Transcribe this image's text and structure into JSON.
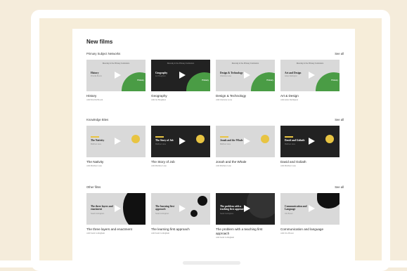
{
  "page": {
    "title": "New films"
  },
  "sections": [
    {
      "title": "Primary Subject Networks",
      "see_all": "See all",
      "cards": [
        {
          "thumb_top": "Diversity in the Primary Curriculum",
          "thumb_title": "History",
          "thumb_sub": "Priscilla Broom",
          "badge": "Primary",
          "title": "History",
          "subtitle": "with Priscilla Broom"
        },
        {
          "thumb_top": "Diversity in the Primary Curriculum",
          "thumb_title": "Geography",
          "thumb_sub": "Jez Boughton",
          "badge": "Primary",
          "title": "Geography",
          "subtitle": "with Jez Boughton"
        },
        {
          "thumb_top": "Diversity in the Primary Curriculum",
          "thumb_title": "Design & Technology",
          "thumb_sub": "Charlotte Lowe",
          "badge": "Primary",
          "title": "Design & Technology",
          "subtitle": "with Charlotte Lowe"
        },
        {
          "thumb_top": "Diversity in the Primary Curriculum",
          "thumb_title": "Art and Design",
          "thumb_sub": "Adele Darlington",
          "badge": "Primary",
          "title": "Art & Design",
          "subtitle": "with Adele Darlington"
        }
      ]
    },
    {
      "title": "Knowledge Bites",
      "see_all": "See all",
      "cards": [
        {
          "thumb_title": "The Nativity",
          "thumb_sub": "Matthew Lane",
          "title": "The Nativity",
          "subtitle": "with Matthew Lane"
        },
        {
          "thumb_title": "The Story of Job",
          "thumb_sub": "Matthew Lane",
          "title": "The Story of Job",
          "subtitle": "with Matthew Lane"
        },
        {
          "thumb_title": "Jonah and the Whale",
          "thumb_sub": "Matthew Lane",
          "title": "Jonah and the Whale",
          "subtitle": "with Matthew Lane"
        },
        {
          "thumb_title": "David and Goliath",
          "thumb_sub": "Matthew Lane",
          "title": "David and Goliath",
          "subtitle": "with Matthew Lane"
        }
      ]
    },
    {
      "title": "Other films",
      "see_all": "See all",
      "cards": [
        {
          "thumb_title": "The three layers and enactment",
          "thumb_sub": "Sarah Cottingham",
          "title": "The three layers and enactment",
          "subtitle": "with Sarah Cottingham"
        },
        {
          "thumb_title": "The learning first approach",
          "thumb_sub": "Sarah Cottingham",
          "title": "The learning first approach",
          "subtitle": "with Sarah Cottingham"
        },
        {
          "thumb_title": "The problem with a teaching first approach",
          "thumb_sub": "Sarah Cottingham",
          "title": "The problem with a teaching first approach",
          "subtitle": "with Sarah Cottingham"
        },
        {
          "thumb_title": "Communication and Language",
          "thumb_sub": "Clio Brown",
          "title": "Communication and language",
          "subtitle": "with Clio Brown"
        }
      ]
    }
  ],
  "colors": {
    "background": "#f5ecdb",
    "screen": "#f6edd9",
    "primary_green": "#4a9c45",
    "accent_yellow": "#e8c442",
    "dark_thumb": "#222222",
    "light_thumb": "#d9d9d9"
  },
  "icons": {
    "play": "play-icon"
  }
}
